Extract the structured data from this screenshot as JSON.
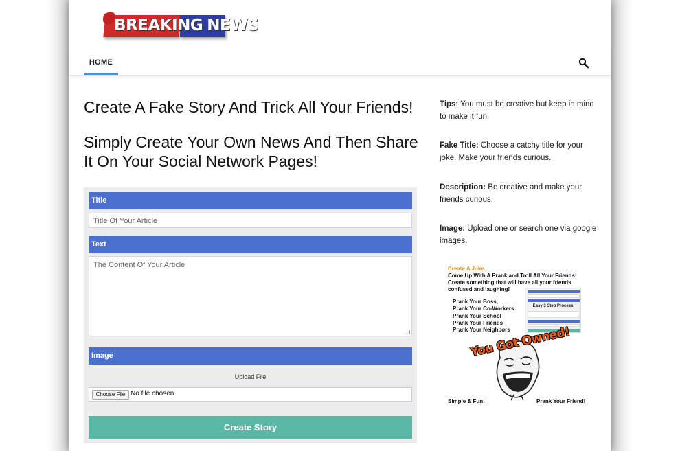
{
  "brand": {
    "logo_text_1": "BREAKING",
    "logo_text_2": "NEWS",
    "colors": {
      "red": "#d02a2a",
      "blue": "#2f3e9c"
    }
  },
  "nav": {
    "home_label": "HOME",
    "search_icon": "search-icon"
  },
  "main": {
    "headline_1": "Create A Fake Story And Trick All Your Friends!",
    "headline_2": "Simply Create Your Own News And Then Share It On Your Social Network Pages!",
    "form": {
      "title_label": "Title",
      "title_placeholder": "Title Of Your Article",
      "text_label": "Text",
      "text_placeholder": "The Content Of Your Article",
      "image_label": "Image",
      "upload_label": "Upload File",
      "choose_file_label": "Choose File",
      "no_file_text": "No file chosen",
      "submit_label": "Create Story",
      "colors": {
        "bar": "#4a6fcf",
        "button": "#5bb8a6"
      }
    }
  },
  "sidebar": {
    "tips": [
      {
        "key": "Tips:",
        "text": " You must be creative but keep in mind to make it fun."
      },
      {
        "key": "Fake Title:",
        "text": " Choose a catchy title for your joke. Make your friends curious."
      },
      {
        "key": "Description:",
        "text": " Be creative and make your friends curious."
      },
      {
        "key": "Image:",
        "text": " Upload one or search one via google images."
      }
    ],
    "promo": {
      "line1": "Create A Joke,",
      "line2": "Come Up With A Prank and Troll All Your Friends! Create something that will have all your friends confused and laughing!",
      "list": [
        "Prank Your Boss,",
        "Prank Your Co-Workers",
        "Prank Your School",
        "Prank Your Friends",
        "Prank Your Neighbors"
      ],
      "mini_label": "Easy 3 Step Process!",
      "owned_text": "You Got Owned!",
      "footer_left": "Simple & Fun!",
      "footer_right": "Prank Your Friend!"
    }
  }
}
